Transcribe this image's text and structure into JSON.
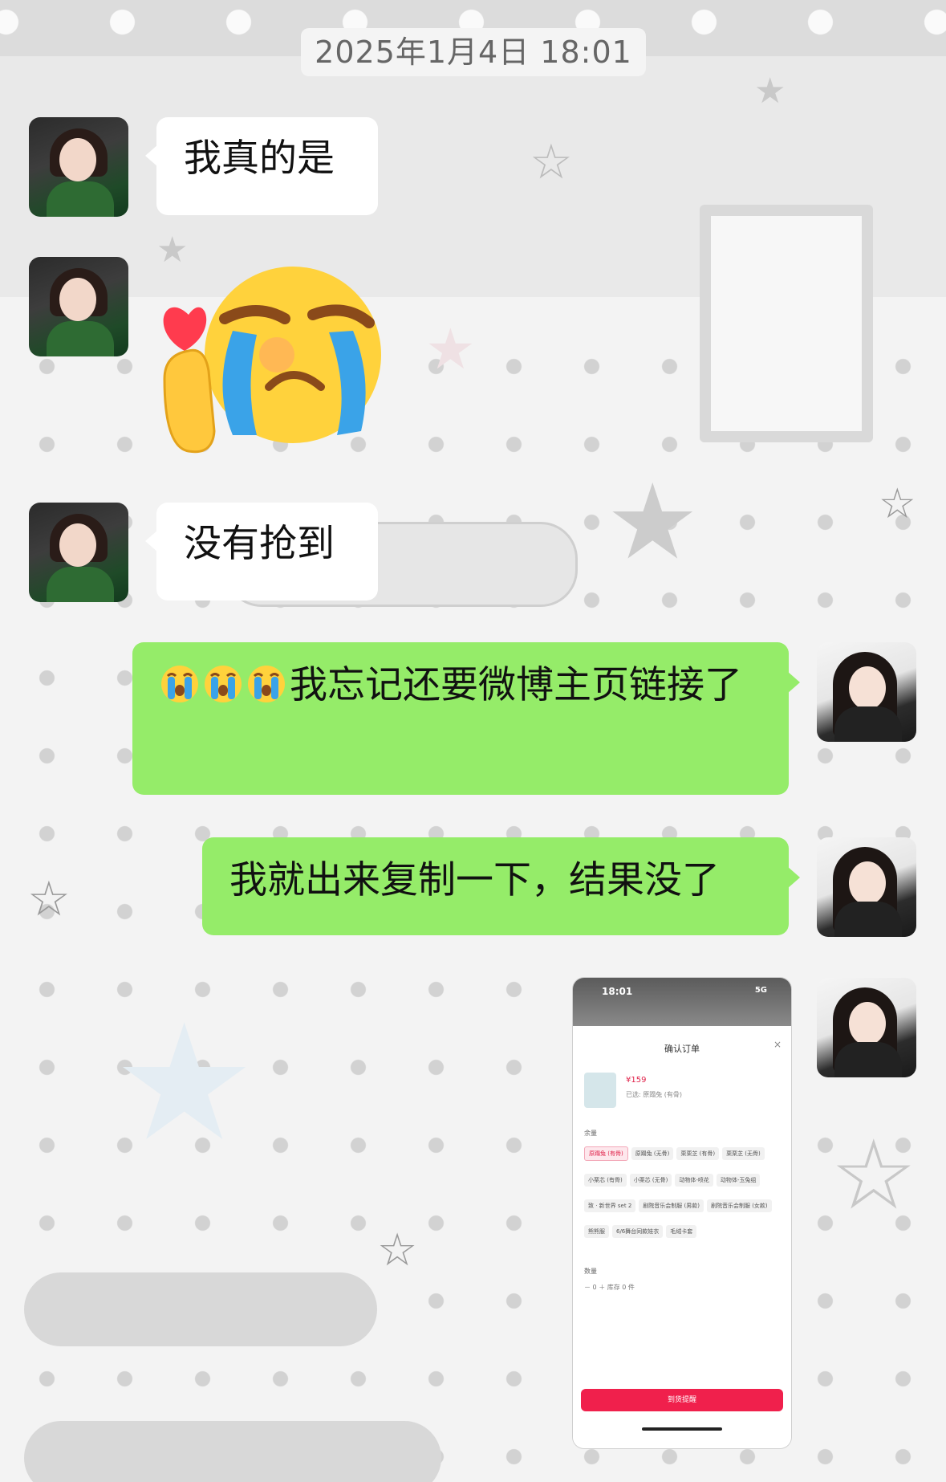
{
  "header": {
    "timestamp": "2025年1月4日 18:01"
  },
  "messages": [
    {
      "side": "left",
      "type": "text",
      "text": "我真的是"
    },
    {
      "side": "left",
      "type": "sticker",
      "sticker": "crying-face-with-heart-hand-sticker"
    },
    {
      "side": "left",
      "type": "text",
      "text": "没有抢到"
    },
    {
      "side": "right",
      "type": "text",
      "emoji_prefix": [
        "loudly-crying-face",
        "loudly-crying-face",
        "loudly-crying-face"
      ],
      "text": "我忘记还要微博主页链接了"
    },
    {
      "side": "right",
      "type": "text",
      "text": "我就出来复制一下，结果没了"
    },
    {
      "side": "right",
      "type": "image",
      "image": "order-confirmation-screenshot"
    }
  ],
  "screenshot": {
    "status_time": "18:01",
    "status_net": "5G",
    "title": "确认订单",
    "close": "×",
    "price": "¥159",
    "selected": "已选: 原蹋兔 (有骨)",
    "section_options": "余量",
    "options": [
      "原蹋兔 (有骨)",
      "原蹋兔 (无骨)",
      "栗栗芝 (有骨)",
      "栗栗芝 (无骨)",
      "小栗芯 (有骨)",
      "小栗芯 (无骨)",
      "动物体-喷花",
      "动物体-玉兔组",
      "致 · 新世界 set 2",
      "剧院音乐会制服 (男款)",
      "剧院音乐会制服 (女款)",
      "熊熊服",
      "6/6舞台同款娃衣",
      "毛绒卡套"
    ],
    "section_qty": "数量",
    "qty_value": "0",
    "qty_hint": "库存 0 件",
    "cta": "到货提醒"
  },
  "colors": {
    "bubble_right": "#95ec69",
    "bubble_left": "#ffffff",
    "cta": "#f0204c"
  }
}
